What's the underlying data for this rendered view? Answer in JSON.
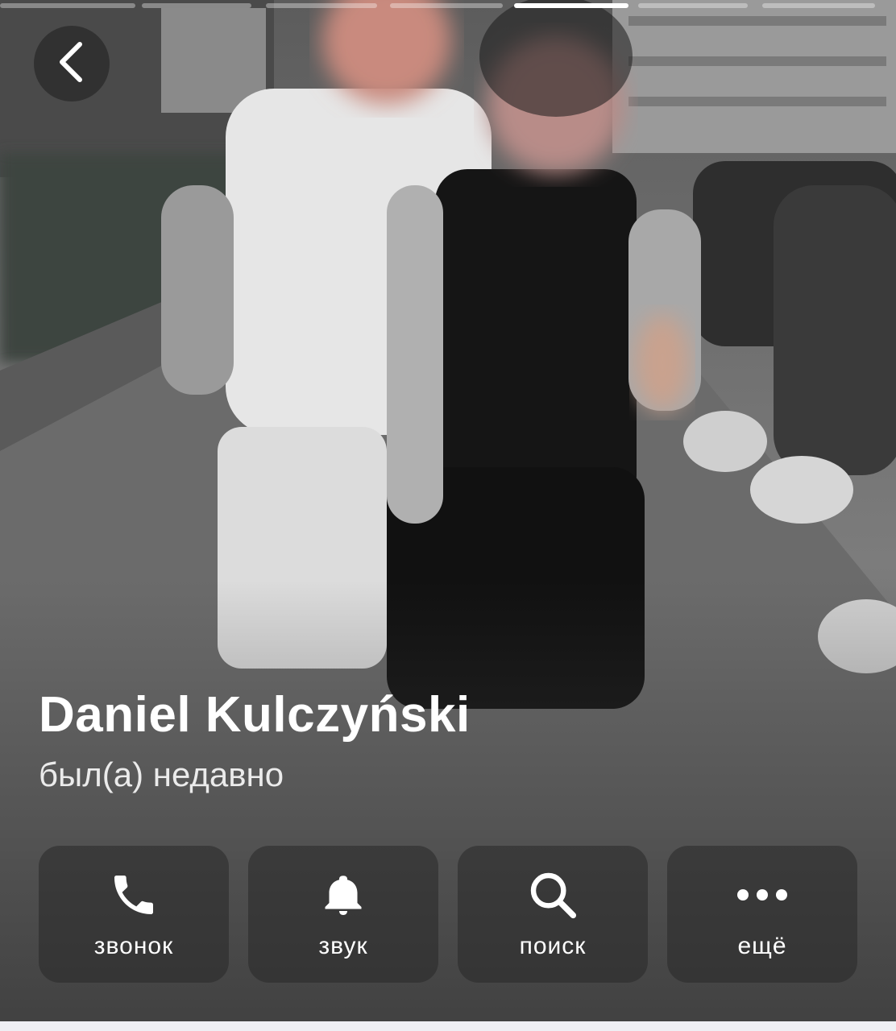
{
  "profile": {
    "name": "Daniel Kulczyński",
    "status": "был(а) недавно"
  },
  "story": {
    "segments_total": 7,
    "active_index": 4
  },
  "actions": [
    {
      "id": "call",
      "label": "звонок",
      "icon": "phone-icon"
    },
    {
      "id": "sound",
      "label": "звук",
      "icon": "bell-icon"
    },
    {
      "id": "search",
      "label": "поиск",
      "icon": "search-icon"
    },
    {
      "id": "more",
      "label": "ещё",
      "icon": "more-dots-icon"
    }
  ],
  "colors": {
    "text": "#ffffff",
    "button_bg": "rgba(40,40,40,0.55)"
  }
}
